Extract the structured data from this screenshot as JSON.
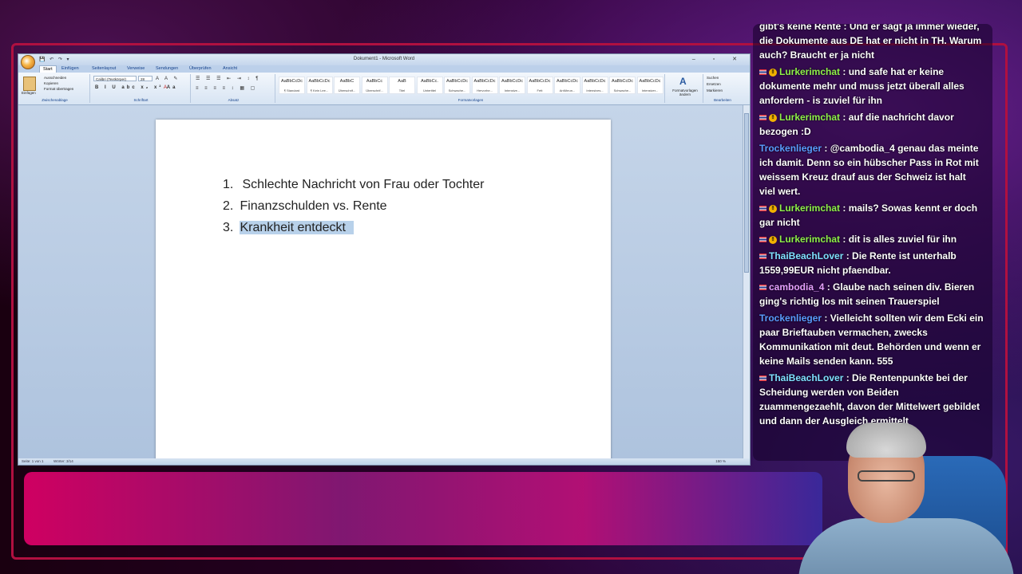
{
  "word": {
    "title": "Dokument1 - Microsoft Word",
    "qat": "💾 ↶ ↷ ▾",
    "window_controls": "– ▫ ✕",
    "tabs": [
      {
        "label": "Start",
        "active": true
      },
      {
        "label": "Einfügen"
      },
      {
        "label": "Seitenlayout"
      },
      {
        "label": "Verweise"
      },
      {
        "label": "Sendungen"
      },
      {
        "label": "Überprüfen"
      },
      {
        "label": "Ansicht"
      }
    ],
    "clipboard": {
      "paste": "Einfügen",
      "cut": "Ausschneiden",
      "copy": "Kopieren",
      "format": "Format übertragen",
      "group": "Zwischenablage"
    },
    "font": {
      "name": "Calibri (Textkörper)",
      "size": "28",
      "group": "Schriftart"
    },
    "paragraph_group": "Absatz",
    "styles": [
      {
        "sample": "AaBbCcDc",
        "name": "¶ Standard"
      },
      {
        "sample": "AaBbCcDc",
        "name": "¶ Kein Lee..."
      },
      {
        "sample": "AaBbC",
        "name": "Überschrif..."
      },
      {
        "sample": "AaBbCc",
        "name": "Überschrif..."
      },
      {
        "sample": "AaB",
        "name": "Titel"
      },
      {
        "sample": "AaBbCc.",
        "name": "Untertitel"
      },
      {
        "sample": "AaBbCcDc",
        "name": "Schwache..."
      },
      {
        "sample": "AaBbCcDc",
        "name": "Hervorhe..."
      },
      {
        "sample": "AaBbCcDc",
        "name": "Intensive..."
      },
      {
        "sample": "AaBbCcDc",
        "name": "Fett"
      },
      {
        "sample": "AaBbCcDc",
        "name": "Anführun..."
      },
      {
        "sample": "AaBbCcDc",
        "name": "Intensives..."
      },
      {
        "sample": "AaBbCcDc",
        "name": "Schwache..."
      },
      {
        "sample": "AaBbCcDc",
        "name": "Intensiver..."
      }
    ],
    "styles_group": "Formatvorlagen",
    "change_styles": "Formatvorlagen ändern",
    "editing": {
      "find": "Suchen",
      "replace": "Ersetzen",
      "select": "Markieren",
      "group": "Bearbeiten"
    },
    "list": [
      {
        "num": "1.",
        "text": "Schlechte Nachricht von Frau oder Tochter"
      },
      {
        "num": "2.",
        "text": "Finanzschulden vs. Rente"
      },
      {
        "num": "3.",
        "text": "Krankheit entdeckt"
      }
    ],
    "status": {
      "page": "Seite: 1 von 1",
      "words": "Wörter: 3/14",
      "zoom": "150 %"
    }
  },
  "chat": {
    "messages": [
      {
        "user": "",
        "text": "gibt's keine Rente : Und er sagt ja immer wieder, die Dokumente aus DE hat er nicht in TH. Warum auch? Braucht er ja nicht",
        "flag": false,
        "badge": false,
        "cls": ""
      },
      {
        "user": "Lurkerimchat",
        "text": "und safe hat er keine dokumente mehr und muss jetzt überall alles anfordern - is zuviel für ihn",
        "flag": true,
        "badge": true,
        "cls": "user-lurker"
      },
      {
        "user": "Lurkerimchat",
        "text": "auf die nachricht davor bezogen :D",
        "flag": true,
        "badge": true,
        "cls": "user-lurker"
      },
      {
        "user": "Trockenlieger",
        "text": "@cambodia_4 genau das meinte ich damit. Denn so ein hübscher Pass in Rot mit weissem Kreuz drauf aus der Schweiz ist halt viel wert.",
        "flag": false,
        "badge": false,
        "cls": "user-trocken"
      },
      {
        "user": "Lurkerimchat",
        "text": "mails? Sowas kennt er doch gar nicht",
        "flag": true,
        "badge": true,
        "cls": "user-lurker"
      },
      {
        "user": "Lurkerimchat",
        "text": "dit is alles zuviel für ihn",
        "flag": true,
        "badge": true,
        "cls": "user-lurker"
      },
      {
        "user": "ThaiBeachLover",
        "text": "Die Rente ist unterhalb 1559,99EUR nicht pfaendbar.",
        "flag": true,
        "badge": false,
        "cls": "user-thai"
      },
      {
        "user": "cambodia_4",
        "text": "Glaube nach seinen div. Bieren ging's richtig los mit seinen Trauerspiel",
        "flag": true,
        "badge": false,
        "cls": "user-camb"
      },
      {
        "user": "Trockenlieger",
        "text": "Vielleicht sollten wir dem Ecki ein paar Brieftauben vermachen, zwecks Kommunikation mit deut. Behörden und wenn er keine Mails senden kann. 555",
        "flag": false,
        "badge": false,
        "cls": "user-trocken"
      },
      {
        "user": "ThaiBeachLover",
        "text": "Die Rentenpunkte bei der Scheidung werden von Beiden zuammengezaehlt, davon der Mittelwert gebildet und dann der Ausgleich ermittelt",
        "flag": true,
        "badge": false,
        "cls": "user-thai"
      }
    ]
  }
}
